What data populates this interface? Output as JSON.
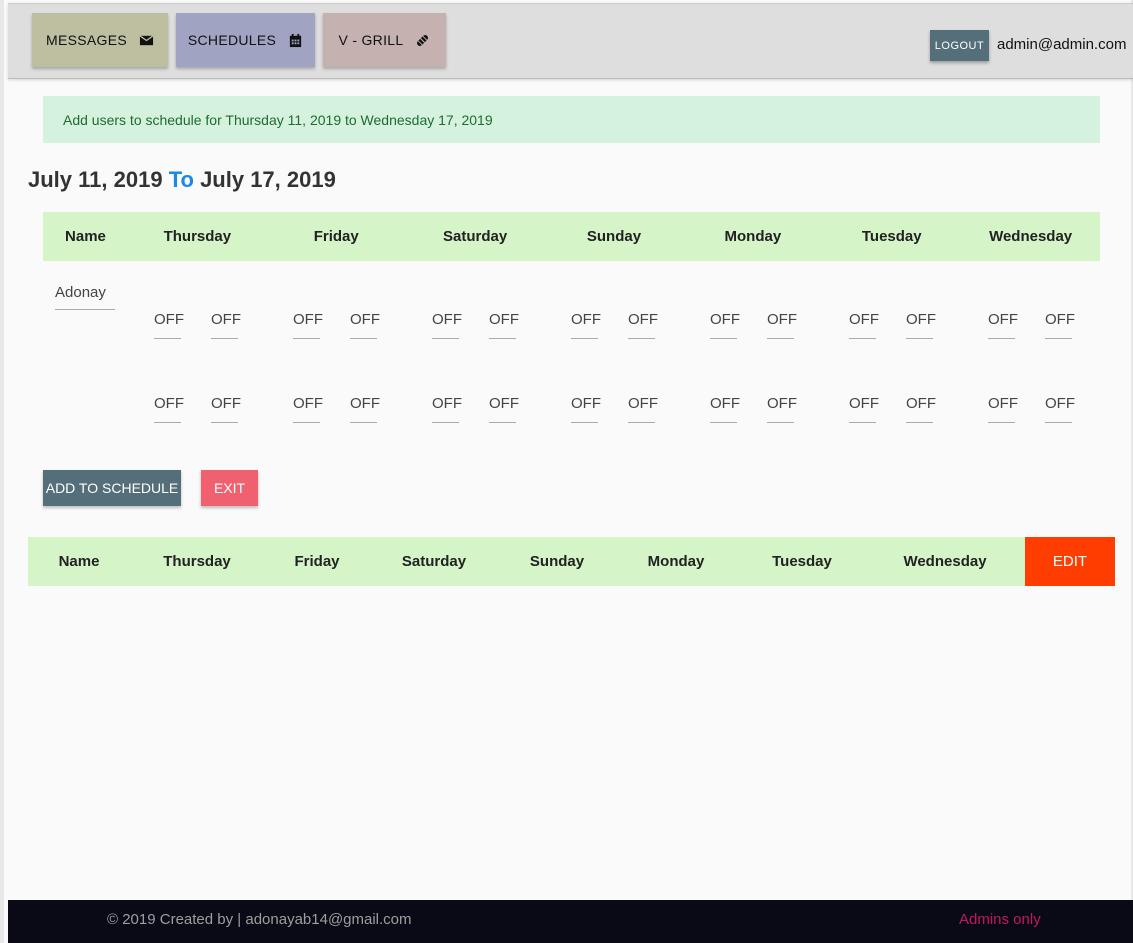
{
  "nav": {
    "messages": {
      "label": "MESSAGES",
      "icon": "envelope-icon"
    },
    "schedules": {
      "label": "SCHEDULES",
      "icon": "calendar-icon"
    },
    "vgrill": {
      "label": "V - GRILL",
      "icon": "pills-icon"
    },
    "logout_label": "LOGOUT",
    "user_email": "admin@admin.com"
  },
  "alert": {
    "text": "Add users to schedule for Thursday 11, 2019 to Wednesday 17, 2019"
  },
  "range": {
    "start": "July 11, 2019",
    "to": "To",
    "end": "July 17, 2019"
  },
  "form_table": {
    "headers": [
      "Name",
      "Thursday",
      "Friday",
      "Saturday",
      "Sunday",
      "Monday",
      "Tuesday",
      "Wednesday"
    ],
    "name_value": "Adonay",
    "shift_value": "OFF"
  },
  "buttons": {
    "add": "ADD TO SCHEDULE",
    "exit": "EXIT"
  },
  "list_table": {
    "headers": [
      "Name",
      "Thursday",
      "Friday",
      "Saturday",
      "Sunday",
      "Monday",
      "Tuesday",
      "Wednesday"
    ],
    "edit": "EDIT"
  },
  "footer": {
    "copyright": "© 2019 Created by | adonayab14@gmail.com",
    "admins": "Admins only"
  },
  "colors": {
    "alert_bg": "#d4f2dd",
    "header_bg": "#d5f4c8",
    "accent_to": "#1e88e5",
    "edit_bg": "#ff3d00",
    "exit_bg": "#f0606f",
    "primary_btn": "#546e7a"
  }
}
